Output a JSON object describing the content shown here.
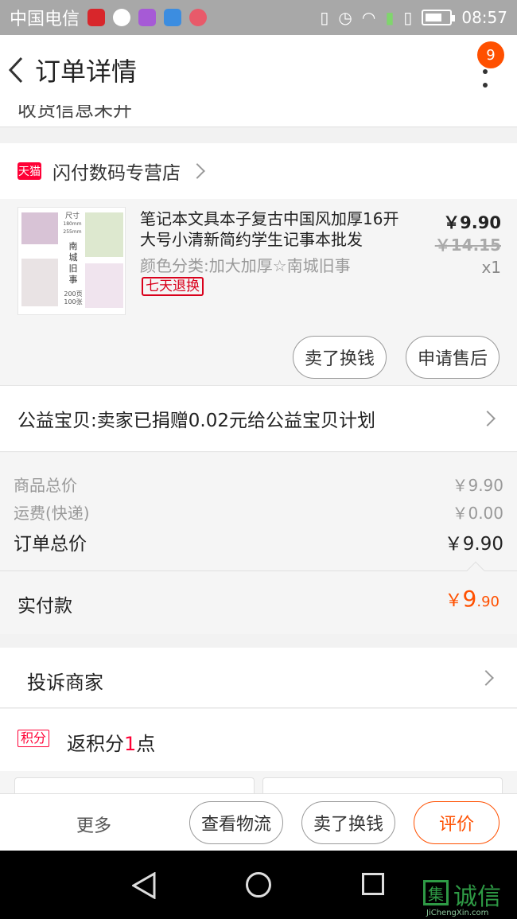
{
  "status_bar": {
    "carrier": "中国电信",
    "time": "08:57",
    "app_icons": [
      "pdd-icon",
      "qq-icon",
      "gallery-icon",
      "files-icon",
      "huawei-icon"
    ]
  },
  "header": {
    "title": "订单详情",
    "notification_count": "9"
  },
  "partial_top_text": "收货信息未开",
  "shop": {
    "tag": "天猫",
    "name": "闪付数码专营店"
  },
  "item": {
    "title": "笔记本文具本子复古中国风加厚16开大号小清新简约学生记事本批发",
    "sku": "颜色分类:加大加厚☆南城旧事",
    "tag": "七天退换",
    "price": "￥9.90",
    "original_price": "￥14.15",
    "quantity": "x1",
    "thumb_text": {
      "size_label": "尺寸",
      "size1": "180mm",
      "size2": "255mm",
      "title": "南城旧事",
      "pages": "200页",
      "sheets": "100张"
    },
    "buttons": {
      "sell": "卖了换钱",
      "after_sale": "申请售后"
    }
  },
  "charity": {
    "text": "公益宝贝:卖家已捐赠0.02元给公益宝贝计划"
  },
  "summary": {
    "goods_label": "商品总价",
    "goods_value": "￥9.90",
    "shipping_label": "运费(快递)",
    "shipping_value": "￥0.00",
    "total_label": "订单总价",
    "total_value": "￥9.90"
  },
  "paid": {
    "label": "实付款",
    "currency": "￥",
    "integer": "9",
    "decimal": ".90"
  },
  "complain": {
    "label": "投诉商家"
  },
  "points": {
    "tag": "积分",
    "prefix": "返积分",
    "count": "1",
    "suffix": "点"
  },
  "action_bar": {
    "more": "更多",
    "logistics": "查看物流",
    "sell": "卖了换钱",
    "review": "评价"
  },
  "watermark": {
    "mark": "集",
    "text": "诚信",
    "sub": "JiChengXin.com"
  },
  "colors": {
    "accent": "#ff5000",
    "tmall": "#ff0036",
    "return_tag": "#d9001b"
  }
}
